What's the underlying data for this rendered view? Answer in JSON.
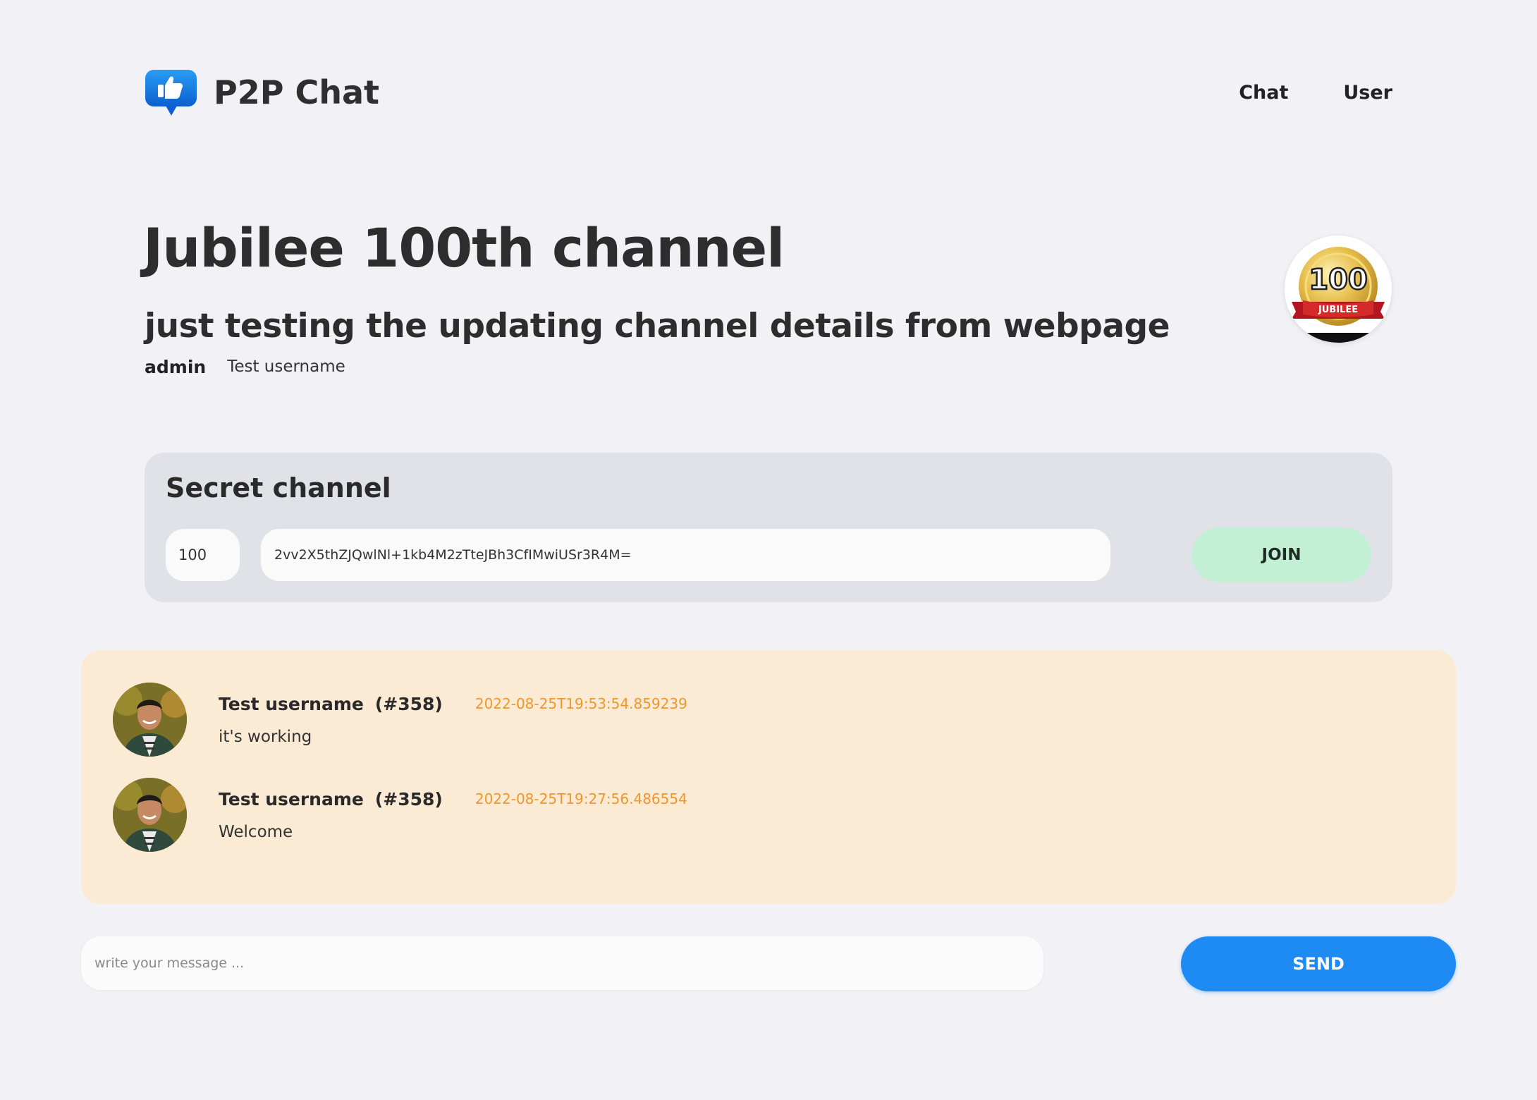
{
  "header": {
    "logo_icon": "thumbs-up-speech-bubble-icon",
    "brand": "P2P Chat",
    "nav": [
      {
        "label": "Chat"
      },
      {
        "label": "User"
      }
    ]
  },
  "channel": {
    "title": "Jubilee 100th channel",
    "description": "just testing the updating channel details from webpage",
    "role": "admin",
    "username": "Test username",
    "badge_icon": "jubilee-100-medal-icon"
  },
  "secret": {
    "title": "Secret channel",
    "channel_id": "100",
    "key": "2vv2X5thZJQwlNl+1kb4M2zTteJBh3CfIMwiUSr3R4M=",
    "join_label": "JOIN"
  },
  "messages": [
    {
      "author": "Test username",
      "id": "(#358)",
      "time": "2022-08-25T19:53:54.859239",
      "text": "it's working"
    },
    {
      "author": "Test username",
      "id": "(#358)",
      "time": "2022-08-25T19:27:56.486554",
      "text": "Welcome"
    }
  ],
  "composer": {
    "placeholder": "write your message ...",
    "send_label": "SEND"
  },
  "colors": {
    "background": "#f2f2f6",
    "secret_box": "#e1e1e8",
    "join_button": "#c3f0d5",
    "messages_panel": "#fbebd5",
    "timestamp": "#f0962a",
    "send_button": "#1e8bf5"
  }
}
